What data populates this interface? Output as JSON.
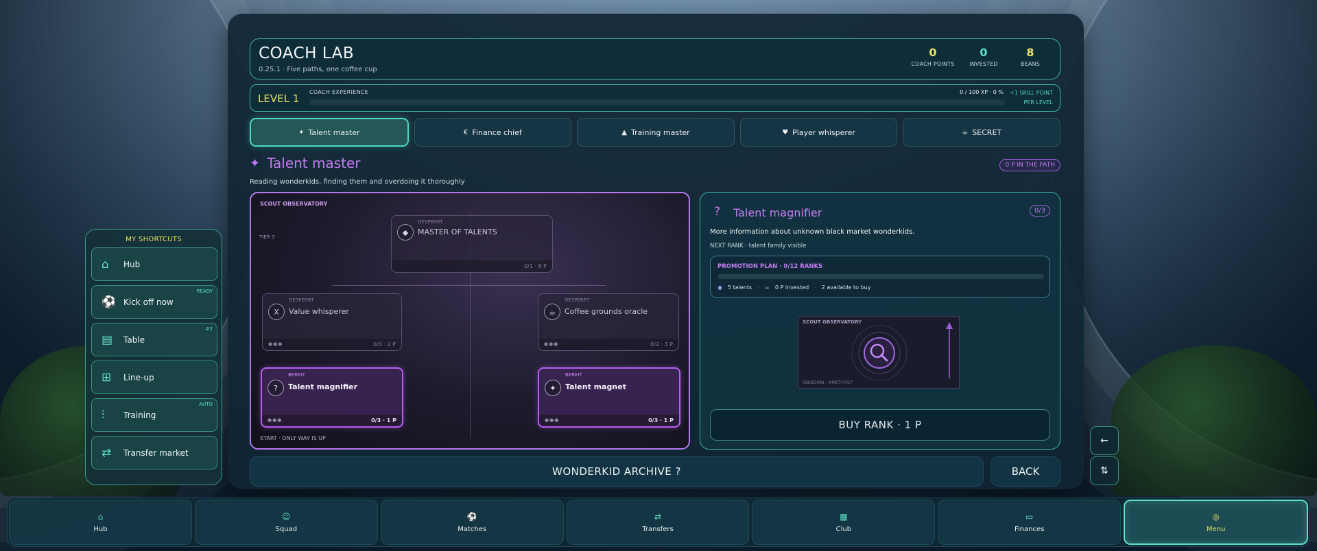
{
  "header": {
    "title": "COACH LAB",
    "version": "0.25.1",
    "tagline": "Five paths, one coffee cup",
    "stats": [
      {
        "value": "0",
        "label": "COACH POINTS",
        "color": "#e9e36a"
      },
      {
        "value": "0",
        "label": "INVESTED",
        "color": "#5fe0c7"
      },
      {
        "value": "8",
        "label": "BEANS",
        "color": "#e9e36a"
      }
    ]
  },
  "level": {
    "label": "LEVEL 1",
    "xp_label": "COACH EXPERIENCE",
    "xp_value": "0 / 100 XP · 0 %",
    "xp_progress": 0,
    "skill_note_1": "+1 SKILL POINT",
    "skill_note_2": "PER LEVEL"
  },
  "tabs": [
    {
      "icon": "✦",
      "icon_name": "sparkle-icon",
      "label": "Talent master",
      "active": true
    },
    {
      "icon": "€",
      "icon_name": "euro-icon",
      "label": "Finance chief",
      "active": false
    },
    {
      "icon": "▲",
      "icon_name": "triangle-icon",
      "label": "Training master",
      "active": false
    },
    {
      "icon": "♥",
      "icon_name": "heart-icon",
      "label": "Player whisperer",
      "active": false
    },
    {
      "icon": "☕",
      "icon_name": "coffee-icon",
      "label": "SECRET",
      "active": false
    }
  ],
  "path": {
    "icon": "✦",
    "title": "Talent master",
    "description": "Reading wonderkids, finding them and overdoing it thoroughly",
    "badge": "0 P IN THE PATH"
  },
  "tree": {
    "label": "SCOUT OBSERVATORY",
    "tier": "TIER 3",
    "start_label": "START · ONLY WAY IS UP",
    "nodes": {
      "master": {
        "state": "GESPERRT",
        "icon": "◆",
        "name": "MASTER OF TALENTS",
        "dots": "",
        "progress": "0/1 · 8 P"
      },
      "value": {
        "state": "GESPERRT",
        "icon": "X",
        "name": "Value whisperer",
        "dots": "●●●",
        "progress": "0/3 · 2 P"
      },
      "coffee": {
        "state": "GESPERRT",
        "icon": "☕",
        "name": "Coffee grounds oracle",
        "dots": "●●●",
        "progress": "0/2 · 3 P"
      },
      "magnifier": {
        "state": "BEREIT",
        "icon": "?",
        "name": "Talent magnifier",
        "dots": "●●●",
        "progress": "0/3 · 1 P"
      },
      "magnet": {
        "state": "BEREIT",
        "icon": "✦",
        "name": "Talent magnet",
        "dots": "●●●",
        "progress": "0/3 · 1 P"
      }
    }
  },
  "detail": {
    "icon": "?",
    "title": "Talent magnifier",
    "badge": "0/3",
    "description": "More information about unknown black market wonderkids.",
    "next_rank": "NEXT RANK · talent family visible",
    "promo_title": "PROMOTION PLAN · 0/12 RANKS",
    "promo_progress": 0,
    "promo_talents": "5 talents",
    "promo_invested": "0 P invested",
    "promo_available": "2 available to buy",
    "scout_label": "SCOUT OBSERVATORY",
    "scout_foot": "OBSIDIAN · AMETHYST",
    "buy_label": "BUY RANK · 1 P"
  },
  "actions": {
    "archive": "WONDERKID ARCHIVE ?",
    "back": "BACK"
  },
  "shortcuts": {
    "title": "MY SHORTCUTS",
    "items": [
      {
        "icon": "⌂",
        "icon_name": "home-icon",
        "label": "Hub",
        "badge": ""
      },
      {
        "icon": "⚽",
        "icon_name": "ball-icon",
        "label": "Kick off now",
        "badge": "READY"
      },
      {
        "icon": "▤",
        "icon_name": "table-icon",
        "label": "Table",
        "badge": "#2"
      },
      {
        "icon": "⊞",
        "icon_name": "lineup-icon",
        "label": "Line-up",
        "badge": ""
      },
      {
        "icon": "⫶",
        "icon_name": "dumbbell-icon",
        "label": "Training",
        "badge": "AUTO"
      },
      {
        "icon": "⇄",
        "icon_name": "transfer-icon",
        "label": "Transfer market",
        "badge": ""
      }
    ]
  },
  "side_buttons": {
    "back_arrow": "←",
    "sort": "⇅"
  },
  "bottom_nav": [
    {
      "icon": "⌂",
      "icon_name": "home-icon",
      "label": "Hub",
      "active": false
    },
    {
      "icon": "☺",
      "icon_name": "squad-icon",
      "label": "Squad",
      "active": false
    },
    {
      "icon": "⚽",
      "icon_name": "ball-icon",
      "label": "Matches",
      "active": false
    },
    {
      "icon": "⇄",
      "icon_name": "transfer-icon",
      "label": "Transfers",
      "active": false
    },
    {
      "icon": "▦",
      "icon_name": "stadium-icon",
      "label": "Club",
      "active": false
    },
    {
      "icon": "▭",
      "icon_name": "wallet-icon",
      "label": "Finances",
      "active": false
    },
    {
      "icon": "◎",
      "icon_name": "menu-icon",
      "label": "Menu",
      "active": true
    }
  ],
  "colors": {
    "accent_teal": "#3fb4a6",
    "accent_purple": "#c47cf0",
    "accent_yellow": "#e9e36a"
  }
}
